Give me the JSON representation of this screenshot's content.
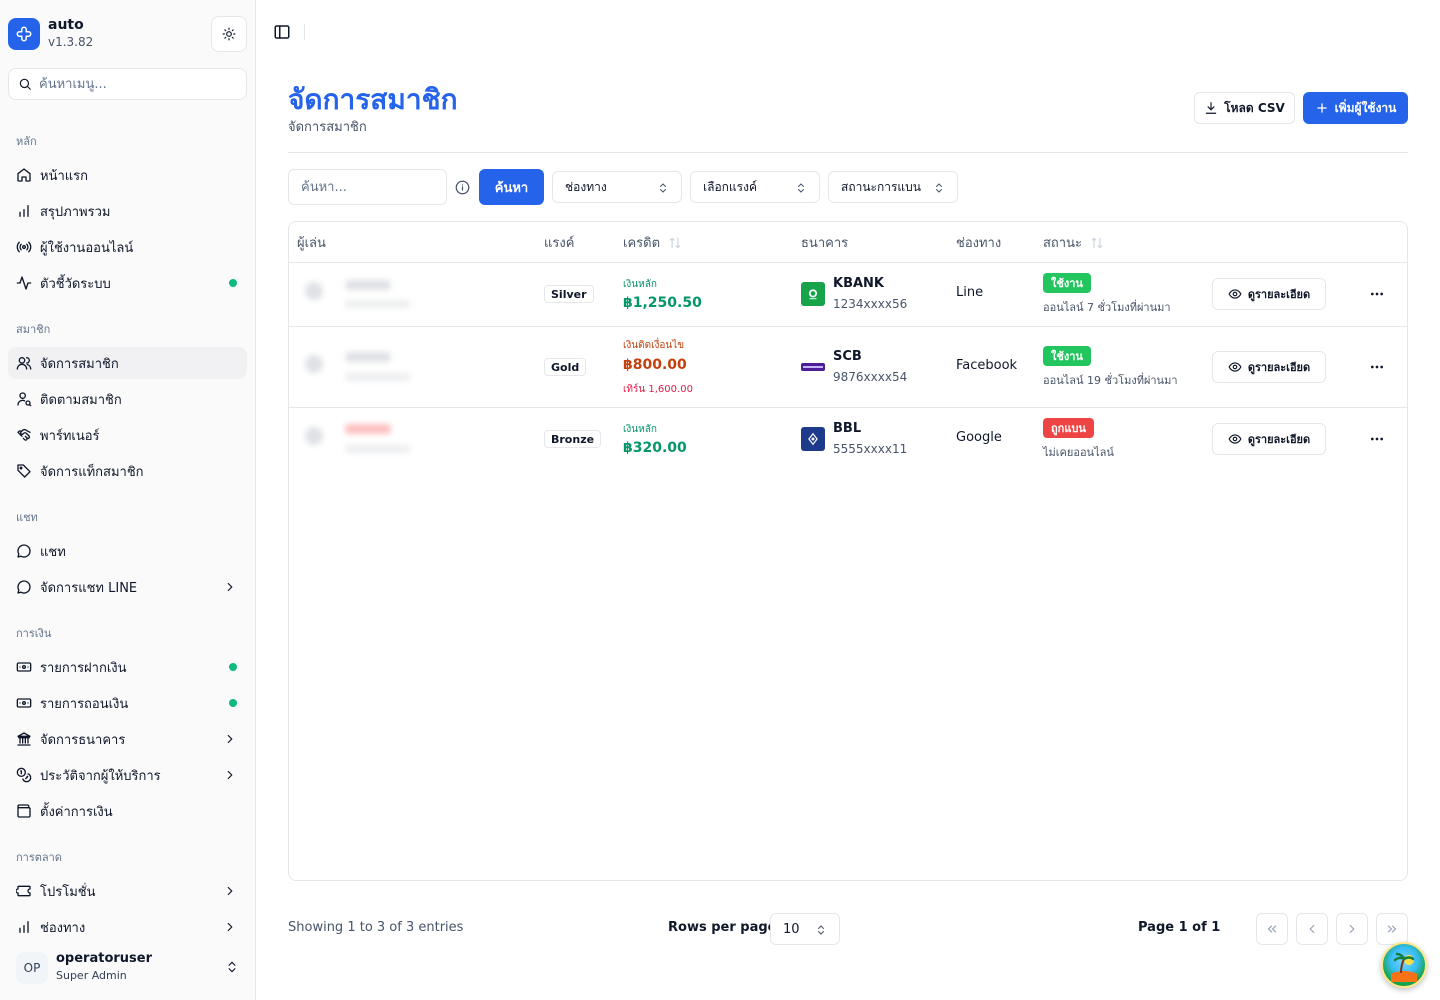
{
  "brand": {
    "name": "auto",
    "version": "v1.3.82"
  },
  "menu_search": {
    "placeholder": "ค้นหาเมนู..."
  },
  "sidebar": {
    "groups": [
      {
        "label": "หลัก",
        "items": [
          {
            "label": "หน้าแรก",
            "icon": "home-icon"
          },
          {
            "label": "สรุปภาพรวม",
            "icon": "bar-chart-icon"
          },
          {
            "label": "ผู้ใช้งานออนไลน์",
            "icon": "radio-icon"
          },
          {
            "label": "ตัวชี้วัดระบบ",
            "icon": "activity-icon",
            "status_dot": "#10b981"
          }
        ]
      },
      {
        "label": "สมาชิก",
        "items": [
          {
            "label": "จัดการสมาชิก",
            "icon": "users-icon",
            "active": true
          },
          {
            "label": "ติดตามสมาชิก",
            "icon": "user-search-icon"
          },
          {
            "label": "พาร์ทเนอร์",
            "icon": "handshake-icon"
          },
          {
            "label": "จัดการแท็กสมาชิก",
            "icon": "tag-icon"
          }
        ]
      },
      {
        "label": "แชท",
        "items": [
          {
            "label": "แชท",
            "icon": "message-circle-icon"
          },
          {
            "label": "จัดการแชท LINE",
            "icon": "message-circle-icon",
            "submenu": true
          }
        ]
      },
      {
        "label": "การเงิน",
        "items": [
          {
            "label": "รายการฝากเงิน",
            "icon": "deposit-icon",
            "status_dot": "#10b981"
          },
          {
            "label": "รายการถอนเงิน",
            "icon": "withdraw-icon",
            "status_dot": "#10b981"
          },
          {
            "label": "จัดการธนาคาร",
            "icon": "bank-icon",
            "submenu": true
          },
          {
            "label": "ประวัติจากผู้ให้บริการ",
            "icon": "coins-icon",
            "submenu": true
          },
          {
            "label": "ตั้งค่าการเงิน",
            "icon": "wallet-icon"
          }
        ]
      },
      {
        "label": "การตลาด",
        "items": [
          {
            "label": "โปรโมชั่น",
            "icon": "ticket-icon",
            "submenu": true
          },
          {
            "label": "ช่องทาง",
            "icon": "bar-chart-icon",
            "submenu": true
          }
        ]
      }
    ]
  },
  "user": {
    "initials": "OP",
    "name": "operatoruser",
    "role": "Super Admin"
  },
  "page": {
    "title": "จัดการสมาชิก",
    "subtitle": "จัดการสมาชิก"
  },
  "actions": {
    "csv_label": "โหลด CSV",
    "add_label": "เพิ่มผู้ใช้งาน"
  },
  "filters": {
    "search_placeholder": "ค้นหา...",
    "search_button": "ค้นหา",
    "channel_select": "ช่องทาง",
    "rank_select": "เลือกแรงค์",
    "ban_select": "สถานะการแบน"
  },
  "table": {
    "headers": {
      "player": "ผู้เล่น",
      "rank": "แรงค์",
      "credit": "เครดิต",
      "bank": "ธนาคาร",
      "channel": "ช่องทาง",
      "status": "สถานะ"
    },
    "rows": [
      {
        "rank": "Silver",
        "credit_label": "เงินหลัก",
        "credit_value": "฿1,250.50",
        "credit_color": "#059669",
        "credit_extra": "",
        "bank": "KBANK",
        "bank_color": "#16a34a",
        "account": "1234xxxx56",
        "channel": "Line",
        "status": "ใช้งาน",
        "status_color": "#22c55e",
        "status_note": "ออนไลน์ 7 ชั่วโมงที่ผ่านมา",
        "detail_label": "ดูรายละเอียด"
      },
      {
        "rank": "Gold",
        "credit_label": "เงินติดเงื่อนไข",
        "credit_value": "฿800.00",
        "credit_color": "#c2410c",
        "credit_extra": "เทิร์น 1,600.00",
        "bank": "SCB",
        "bank_color": "#4c1d95",
        "account": "9876xxxx54",
        "channel": "Facebook",
        "status": "ใช้งาน",
        "status_color": "#22c55e",
        "status_note": "ออนไลน์ 19 ชั่วโมงที่ผ่านมา",
        "detail_label": "ดูรายละเอียด"
      },
      {
        "rank": "Bronze",
        "credit_label": "เงินหลัก",
        "credit_value": "฿320.00",
        "credit_color": "#059669",
        "credit_extra": "",
        "bank": "BBL",
        "bank_color": "#1e3a8a",
        "account": "5555xxxx11",
        "channel": "Google",
        "status": "ถูกแบน",
        "status_color": "#ef4444",
        "status_note": "ไม่เคยออนไลน์",
        "detail_label": "ดูรายละเอียด"
      }
    ]
  },
  "footer": {
    "showing": "Showing 1 to 3 of 3 entries",
    "rows_per_page_label": "Rows per page",
    "rows_per_page_value": "10",
    "page_info": "Page 1 of 1"
  },
  "colors": {
    "accent": "#2563eb",
    "success": "#22c55e",
    "danger": "#ef4444"
  }
}
